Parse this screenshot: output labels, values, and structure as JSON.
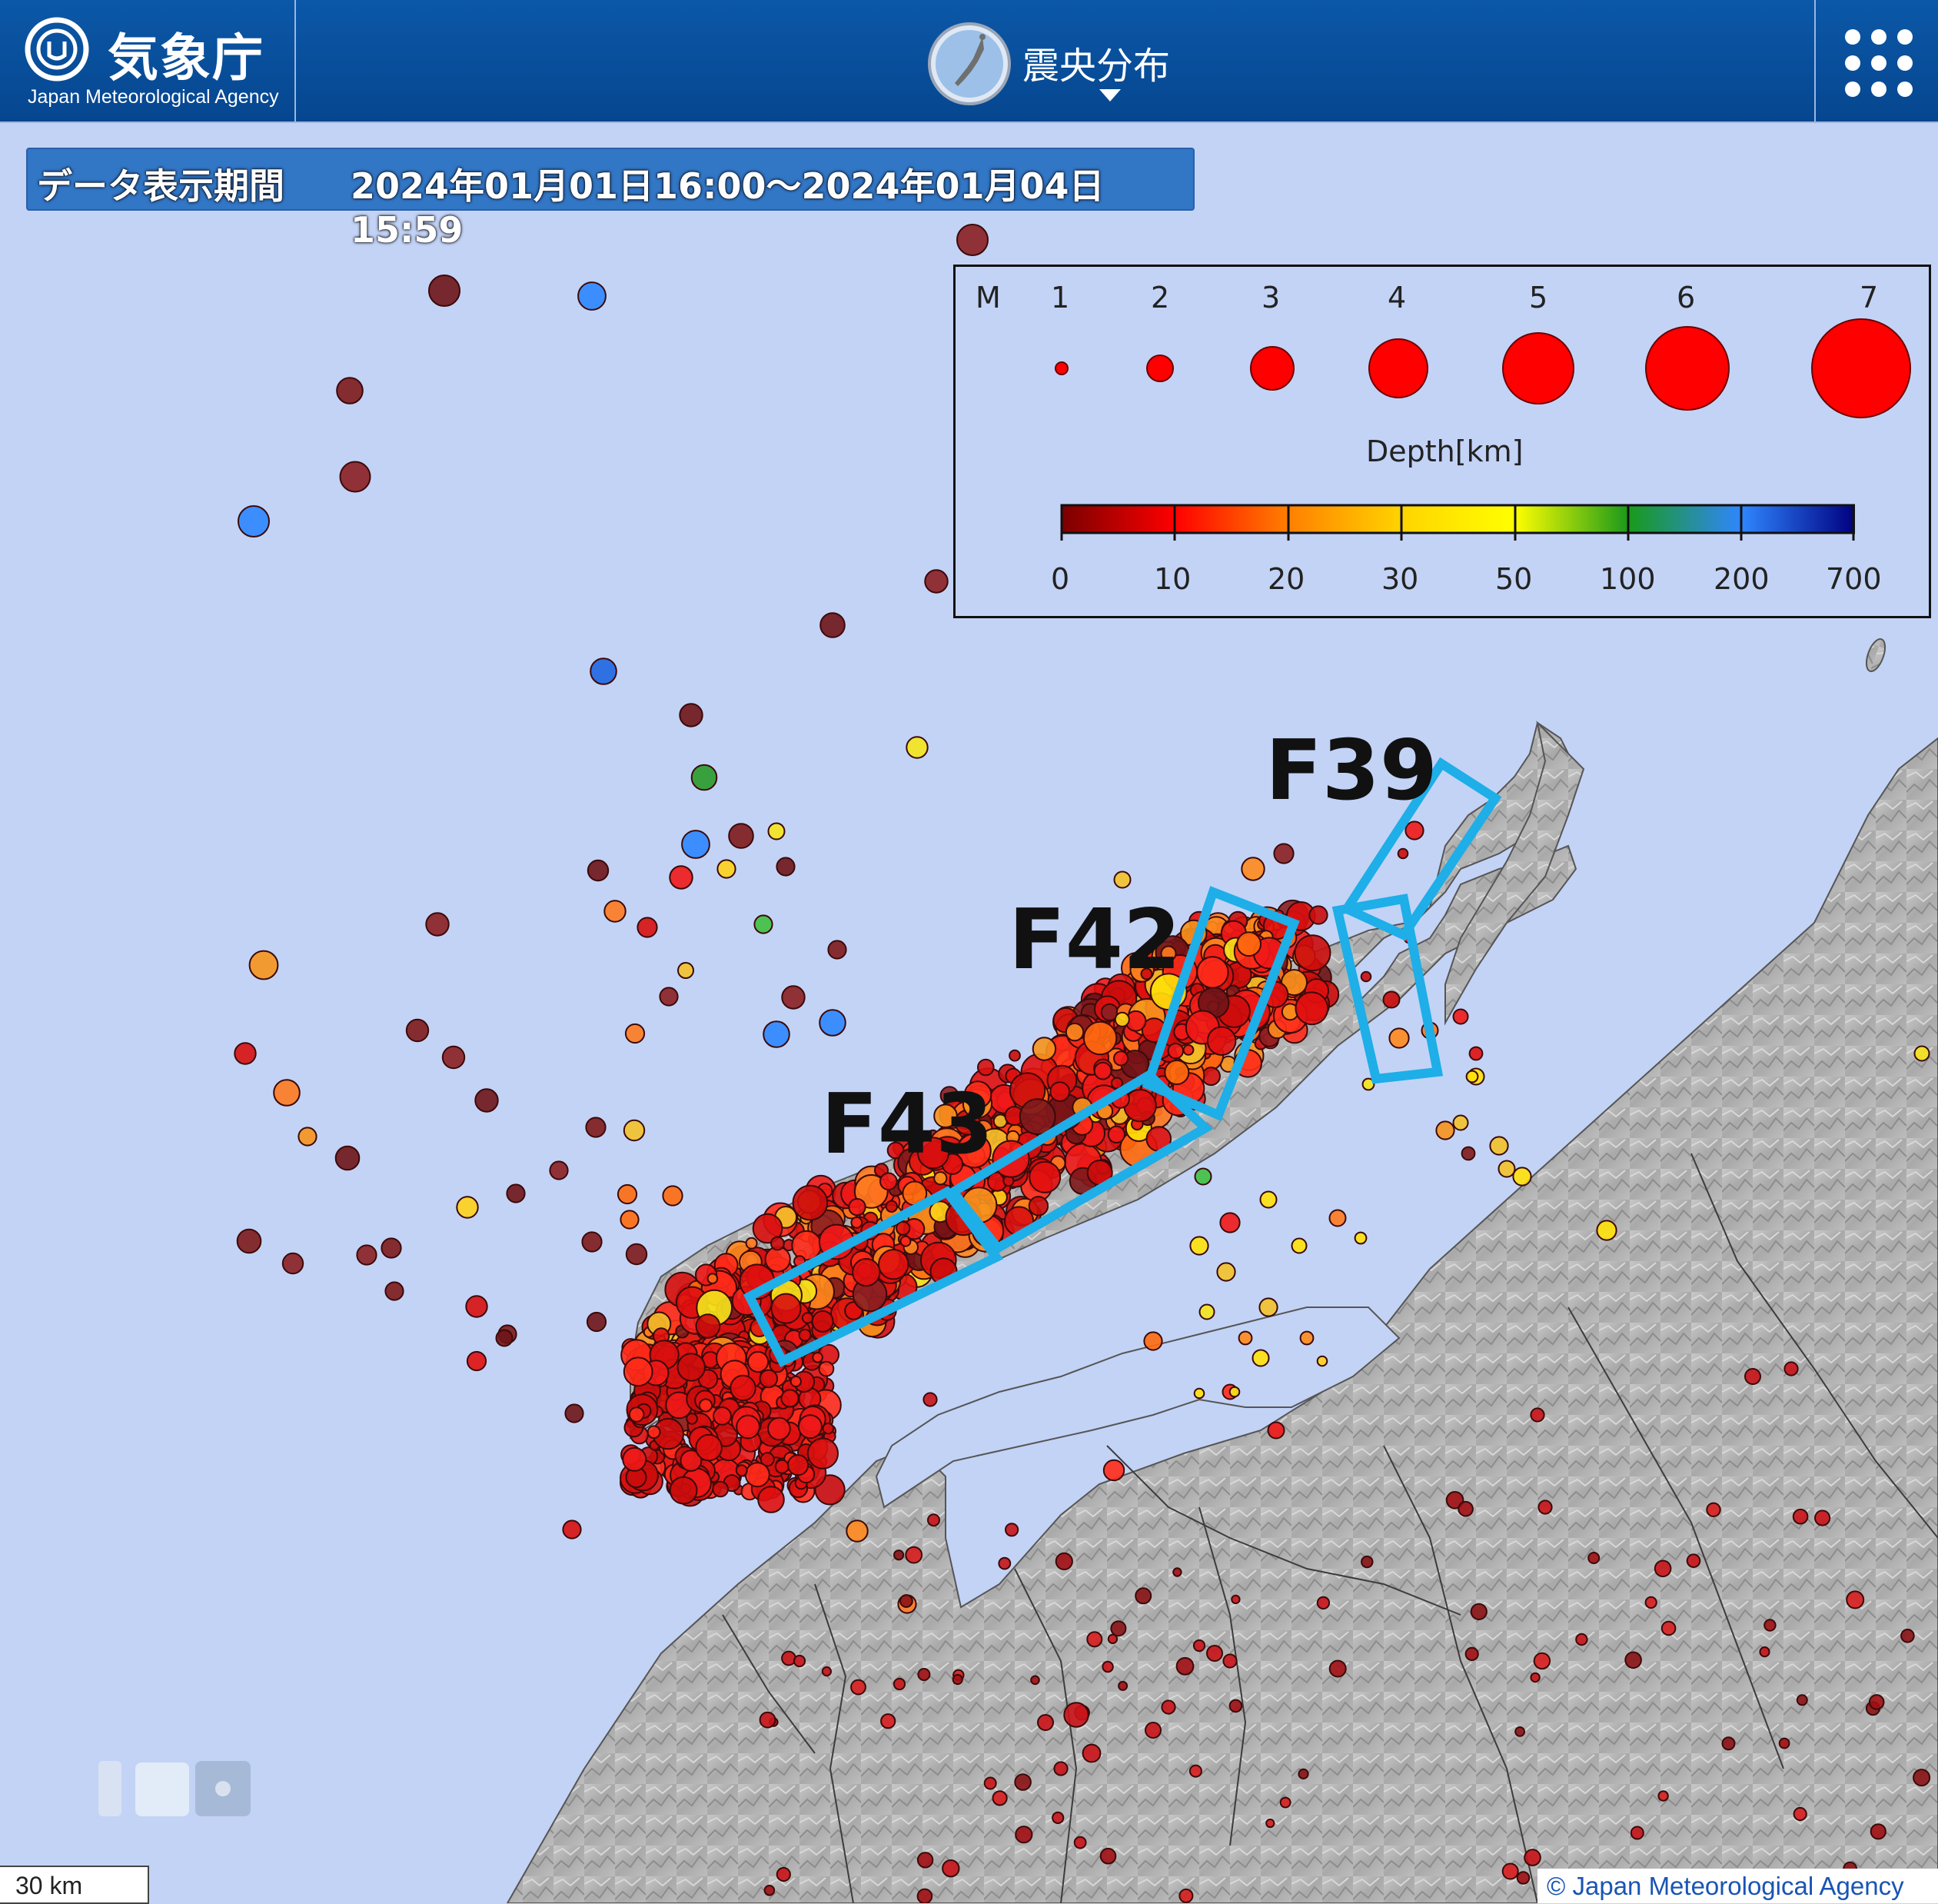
{
  "header": {
    "agency_name": "気象庁",
    "agency_name_en": "Japan Meteorological Agency",
    "view_title": "震央分布",
    "logo_icon": "jma-logo-icon",
    "globe_icon": "japan-globe-icon",
    "menu_icon": "grid-menu-icon"
  },
  "period": {
    "label": "データ表示期間",
    "range": "2024年01月01日16:00～2024年01月04日15:59"
  },
  "legend": {
    "magnitude_label": "M",
    "magnitudes": [
      "1",
      "2",
      "3",
      "4",
      "5",
      "6",
      "7"
    ],
    "depth_title": "Depth[km]",
    "depth_ticks": [
      "0",
      "10",
      "20",
      "30",
      "50",
      "100",
      "200",
      "700"
    ],
    "depth_colors": [
      "#7a0000",
      "#ff0000",
      "#ff8000",
      "#ffff00",
      "#00a000",
      "#0070ff",
      "#000080"
    ],
    "symbol_color": "#ff0000"
  },
  "faults": [
    {
      "label": "F39",
      "color": "#1eaee8"
    },
    {
      "label": "F42",
      "color": "#1eaee8"
    },
    {
      "label": "F43",
      "color": "#1eaee8"
    }
  ],
  "scale": {
    "label": "30 km"
  },
  "copyright": "© Japan Meteorological Agency",
  "colors": {
    "sea": "#c3d3f6",
    "land": "#b4b4b4",
    "header": "#0a52a2",
    "fault_outline": "#1eaee8"
  }
}
